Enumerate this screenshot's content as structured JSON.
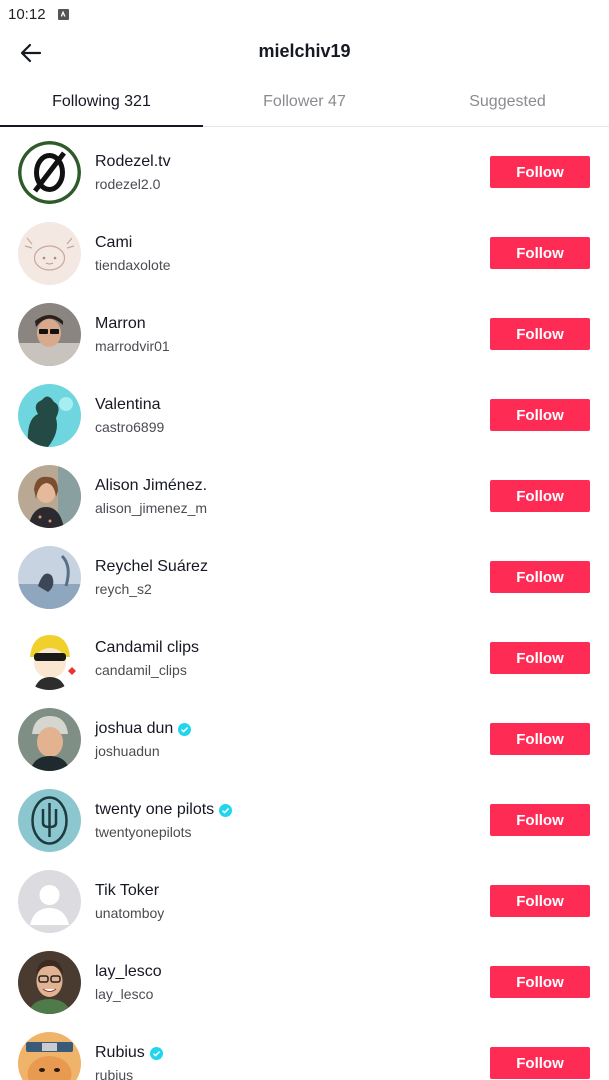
{
  "status_bar": {
    "time": "10:12",
    "icon": "android-notification-icon"
  },
  "header": {
    "title": "mielchiv19",
    "back_icon": "arrow-left-icon"
  },
  "tabs": [
    {
      "label": "Following 321",
      "active": true
    },
    {
      "label": "Follower 47",
      "active": false
    },
    {
      "label": "Suggested",
      "active": false
    }
  ],
  "accent_color": "#fe2c55",
  "verified_color": "#20d5ec",
  "users": [
    {
      "name": "Rodezel.tv",
      "username": "rodezel2.0",
      "verified": false,
      "button": "Follow"
    },
    {
      "name": "Cami",
      "username": "tiendaxolote",
      "verified": false,
      "button": "Follow"
    },
    {
      "name": "Marron",
      "username": "marrodvir01",
      "verified": false,
      "button": "Follow"
    },
    {
      "name": "Valentina",
      "username": "castro6899",
      "verified": false,
      "button": "Follow"
    },
    {
      "name": "Alison Jiménez.",
      "username": "alison_jimenez_m",
      "verified": false,
      "button": "Follow"
    },
    {
      "name": "Reychel Suárez",
      "username": "reych_s2",
      "verified": false,
      "button": "Follow"
    },
    {
      "name": "Candamil clips",
      "username": "candamil_clips",
      "verified": false,
      "button": "Follow"
    },
    {
      "name": "joshua dun",
      "username": "joshuadun",
      "verified": true,
      "button": "Follow"
    },
    {
      "name": "twenty one pilots",
      "username": "twentyonepilots",
      "verified": true,
      "button": "Follow"
    },
    {
      "name": "Tik Toker",
      "username": "unatomboy",
      "verified": false,
      "button": "Follow"
    },
    {
      "name": "lay_lesco",
      "username": "lay_lesco",
      "verified": false,
      "button": "Follow"
    },
    {
      "name": "Rubius",
      "username": "rubius",
      "verified": true,
      "button": "Follow"
    }
  ]
}
